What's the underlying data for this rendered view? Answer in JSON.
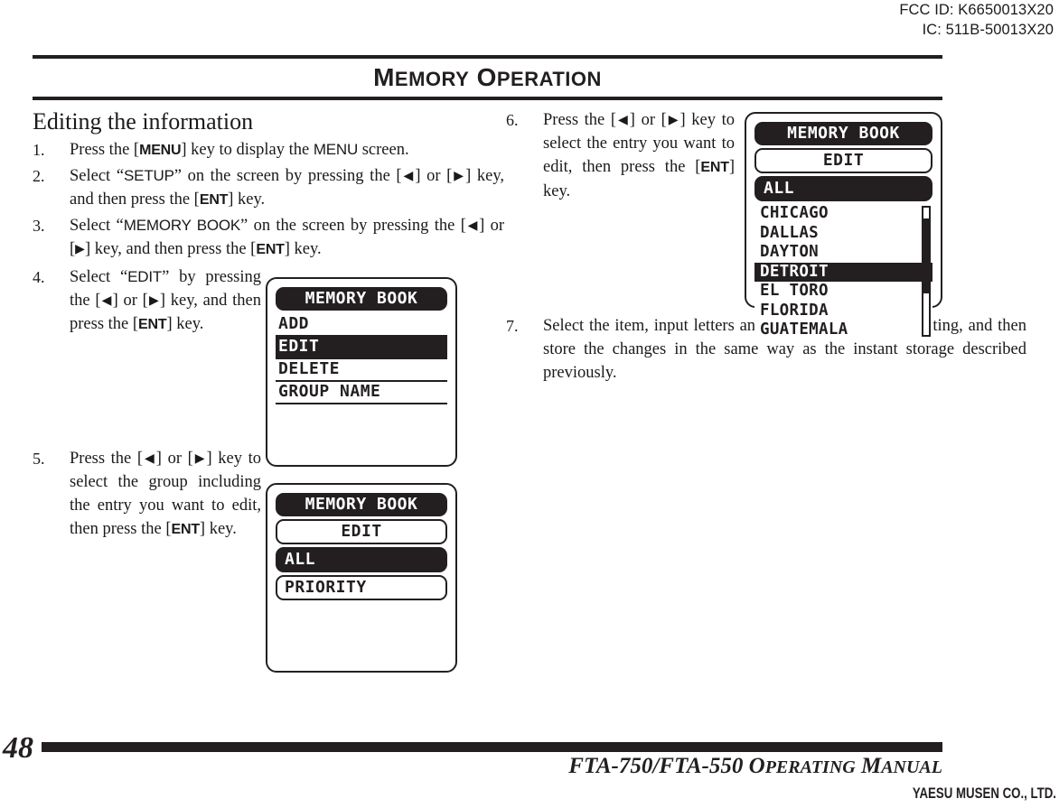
{
  "certification": {
    "fcc_id": "FCC ID: K6650013X20",
    "ic_id": "IC: 511B-50013X20"
  },
  "header": {
    "title_lead": "M",
    "title_rest_1": "EMORY",
    "title_lead2": "O",
    "title_rest_2": "PERATION",
    "title_full": "MEMORY OPERATION"
  },
  "section": {
    "title": "Editing the information"
  },
  "steps": {
    "s1": {
      "num": "1.",
      "p1": "Press the [",
      "key1": "MENU",
      "p2": "] key to display the ",
      "ui1": "MENU",
      "p3": " screen."
    },
    "s2": {
      "num": "2.",
      "p1": "Select “",
      "ui1": "SETUP",
      "p2": "” on the screen by pressing the [",
      "arrow_left": "◀",
      "p3": "] or [",
      "arrow_right": "▶",
      "p4": "] key, and then press the [",
      "key1": "ENT",
      "p5": "] key."
    },
    "s3": {
      "num": "3.",
      "p1": "Select “",
      "ui1": "MEMORY BOOK",
      "p2": "” on the screen by pressing the [",
      "arrow_left": "◀",
      "p3": "] or [",
      "arrow_right": "▶",
      "p4": "] key, and then press the [",
      "key1": "ENT",
      "p5": "] key."
    },
    "s4": {
      "num": "4.",
      "p1": "Select “",
      "ui1": "EDIT",
      "p2": "” by pressing the [",
      "arrow_left": "◀",
      "p3": "] or [",
      "arrow_right": "▶",
      "p4": "] key, and then press the [",
      "key1": "ENT",
      "p5": "] key."
    },
    "s5": {
      "num": "5.",
      "p1": "Press the [",
      "arrow_left": "◀",
      "p2": "] or [",
      "arrow_right": "▶",
      "p3": "] key to select the group including the entry you want to edit, then press the [",
      "key1": "ENT",
      "p4": "] key."
    },
    "s6": {
      "num": "6.",
      "p1": "Press the [",
      "arrow_left": "◀",
      "p2": "] or [",
      "arrow_right": "▶",
      "p3": "] key to select the entry you want to edit, then press the [",
      "key1": "ENT",
      "p4": "] key."
    },
    "s7": {
      "num": "7.",
      "text": "Select the item, input letters and/or numerics, select a setting, and then store the changes in the same way as the instant storage described previously."
    }
  },
  "lcd_screen_1": {
    "title": "MEMORY  BOOK",
    "rows": [
      {
        "label": "ADD",
        "selected": false
      },
      {
        "label": "EDIT",
        "selected": true
      },
      {
        "label": "DELETE",
        "selected": false
      },
      {
        "label": "GROUP  NAME",
        "selected": false
      }
    ]
  },
  "lcd_screen_2": {
    "title": "MEMORY  BOOK",
    "subtitle": "EDIT",
    "pills": [
      {
        "label": "ALL",
        "selected": true
      },
      {
        "label": "PRIORITY",
        "selected": false
      }
    ]
  },
  "lcd_screen_3": {
    "title": "MEMORY  BOOK",
    "subtitle": "EDIT",
    "group": {
      "label": "ALL",
      "selected": true
    },
    "entries": [
      {
        "label": "CHICAGO",
        "selected": false
      },
      {
        "label": "DALLAS",
        "selected": false
      },
      {
        "label": "DAYTON",
        "selected": false
      },
      {
        "label": "DETROIT",
        "selected": true
      },
      {
        "label": "EL TORO",
        "selected": false
      },
      {
        "label": "FLORIDA",
        "selected": false
      },
      {
        "label": "GUATEMALA",
        "selected": false
      }
    ]
  },
  "footer": {
    "page_number": "48",
    "manual_lead": "FTA-750/FTA-550 O",
    "manual_sc1": "PERATING",
    "manual_mid": " M",
    "manual_sc2": "ANUAL",
    "brand": "YAESU MUSEN CO., LTD."
  },
  "colors": {
    "ink": "#231f20",
    "paper": "#ffffff"
  }
}
